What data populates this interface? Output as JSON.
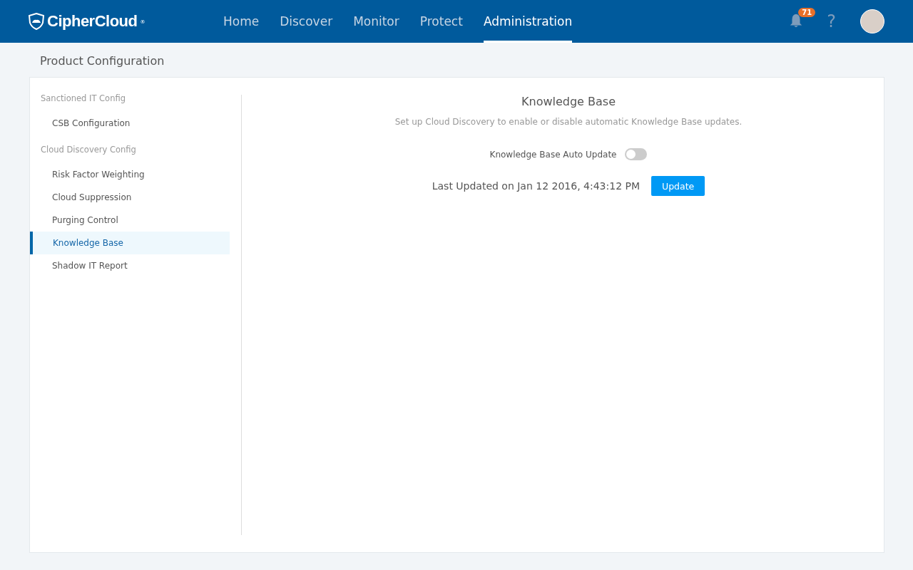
{
  "header": {
    "logo": {
      "name": "CipherCloud",
      "mark": "®"
    },
    "nav": [
      {
        "label": "Home",
        "selected": false
      },
      {
        "label": "Discover",
        "selected": false
      },
      {
        "label": "Monitor",
        "selected": false
      },
      {
        "label": "Protect",
        "selected": false
      },
      {
        "label": "Administration",
        "selected": true
      }
    ],
    "notifications": {
      "count": "71"
    },
    "help": "?"
  },
  "page_title": "Product Configuration",
  "sidebar": {
    "groups": [
      {
        "title": "Sanctioned IT Config",
        "items": [
          {
            "label": "CSB Configuration",
            "selected": false
          }
        ]
      },
      {
        "title": "Cloud Discovery Config",
        "items": [
          {
            "label": "Risk Factor Weighting",
            "selected": false
          },
          {
            "label": "Cloud Suppression",
            "selected": false
          },
          {
            "label": "Purging Control",
            "selected": false
          },
          {
            "label": "Knowledge Base",
            "selected": true
          },
          {
            "label": "Shadow IT Report",
            "selected": false
          }
        ]
      }
    ]
  },
  "content": {
    "title": "Knowledge Base",
    "description": "Set up Cloud Discovery to enable or disable automatic Knowledge Base updates.",
    "auto_update": {
      "label": "Knowledge Base Auto Update",
      "on": false
    },
    "last_updated": "Last Updated on Jan 12 2016, 4:43:12 PM",
    "button": "Update"
  }
}
